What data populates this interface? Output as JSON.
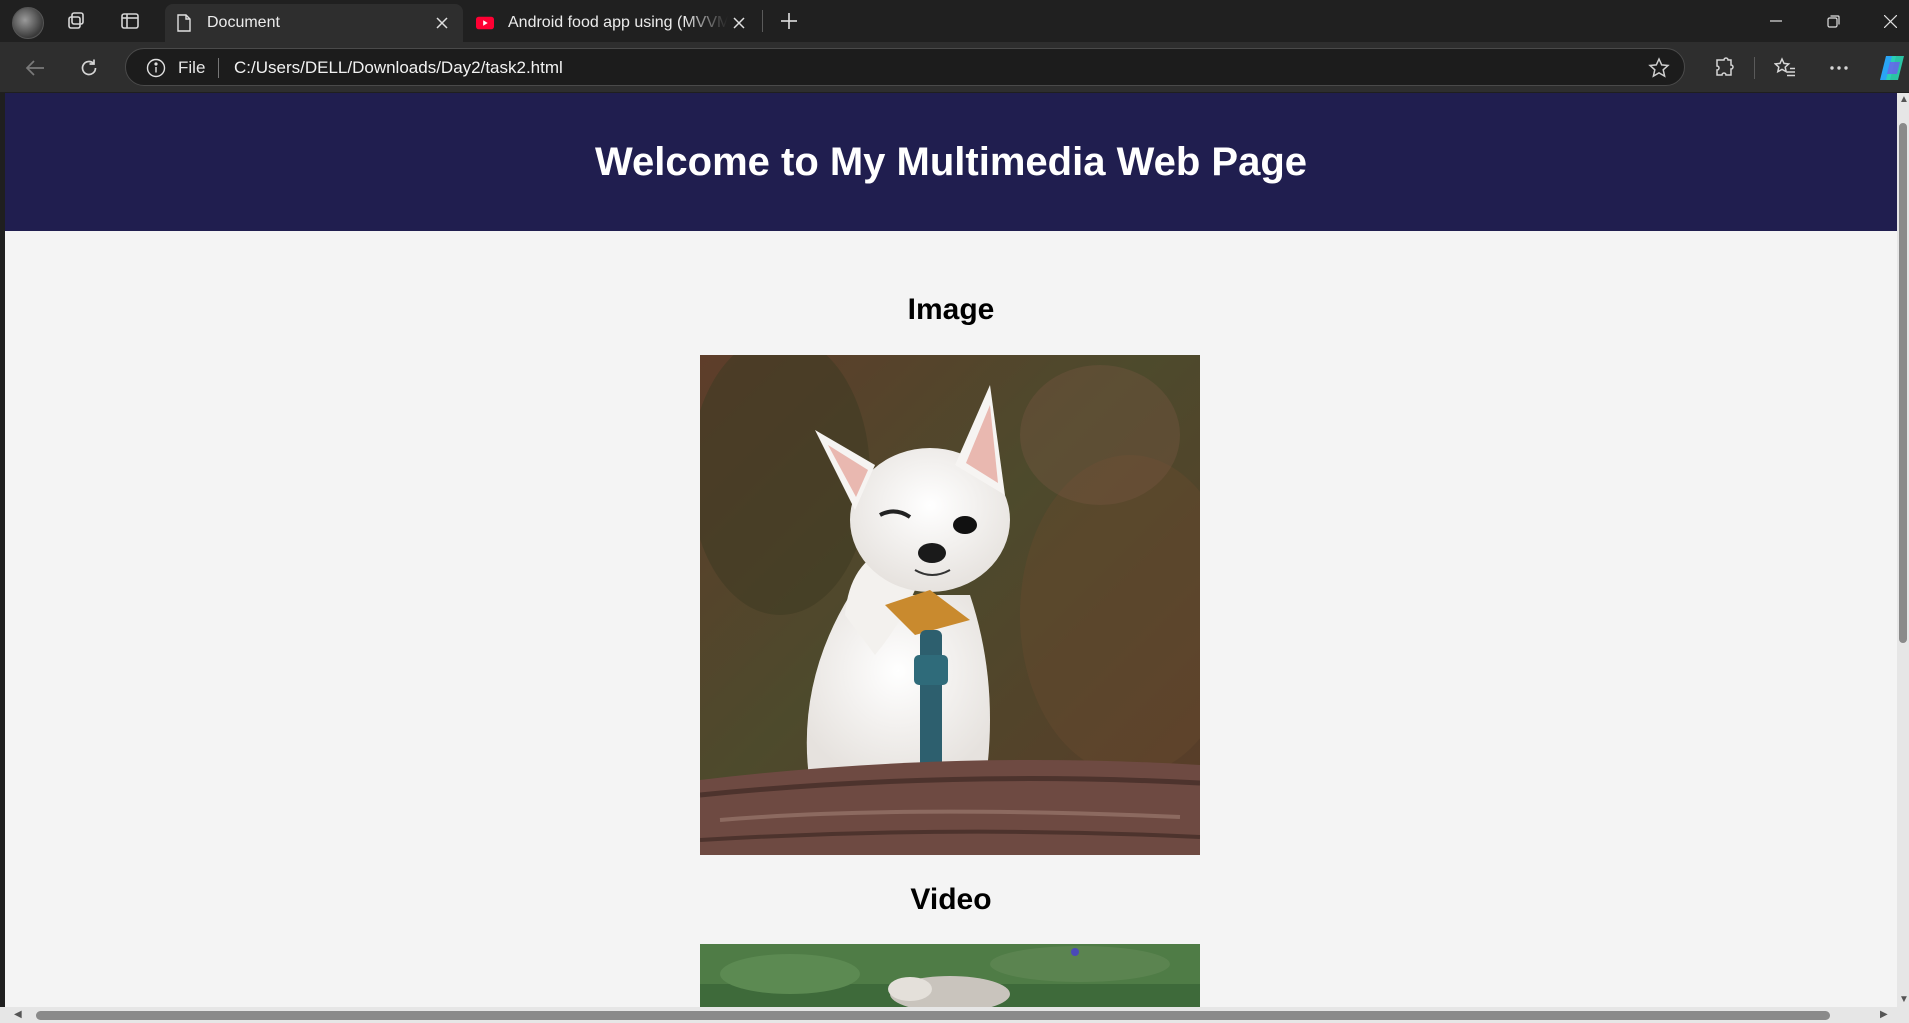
{
  "browser": {
    "tabs": [
      {
        "title": "Document",
        "active": true
      },
      {
        "title": "Android food app using (MVVM + Retrofit)",
        "active": false,
        "favicon": "youtube-icon"
      }
    ],
    "address_bar": {
      "scheme_label": "File",
      "url": "C:/Users/DELL/Downloads/Day2/task2.html"
    },
    "colors": {
      "frame": "#202020",
      "toolbar": "#2e2e2e",
      "omnibox": "#1c1c1c"
    }
  },
  "page": {
    "header": {
      "title": "Welcome to My Multimedia Web Page",
      "bg": "#201e4f"
    },
    "sections": {
      "image": {
        "title": "Image",
        "alt": "White chihuahua winking with paw raised behind a log"
      },
      "video": {
        "title": "Video"
      }
    },
    "background": "#f4f4f4"
  }
}
